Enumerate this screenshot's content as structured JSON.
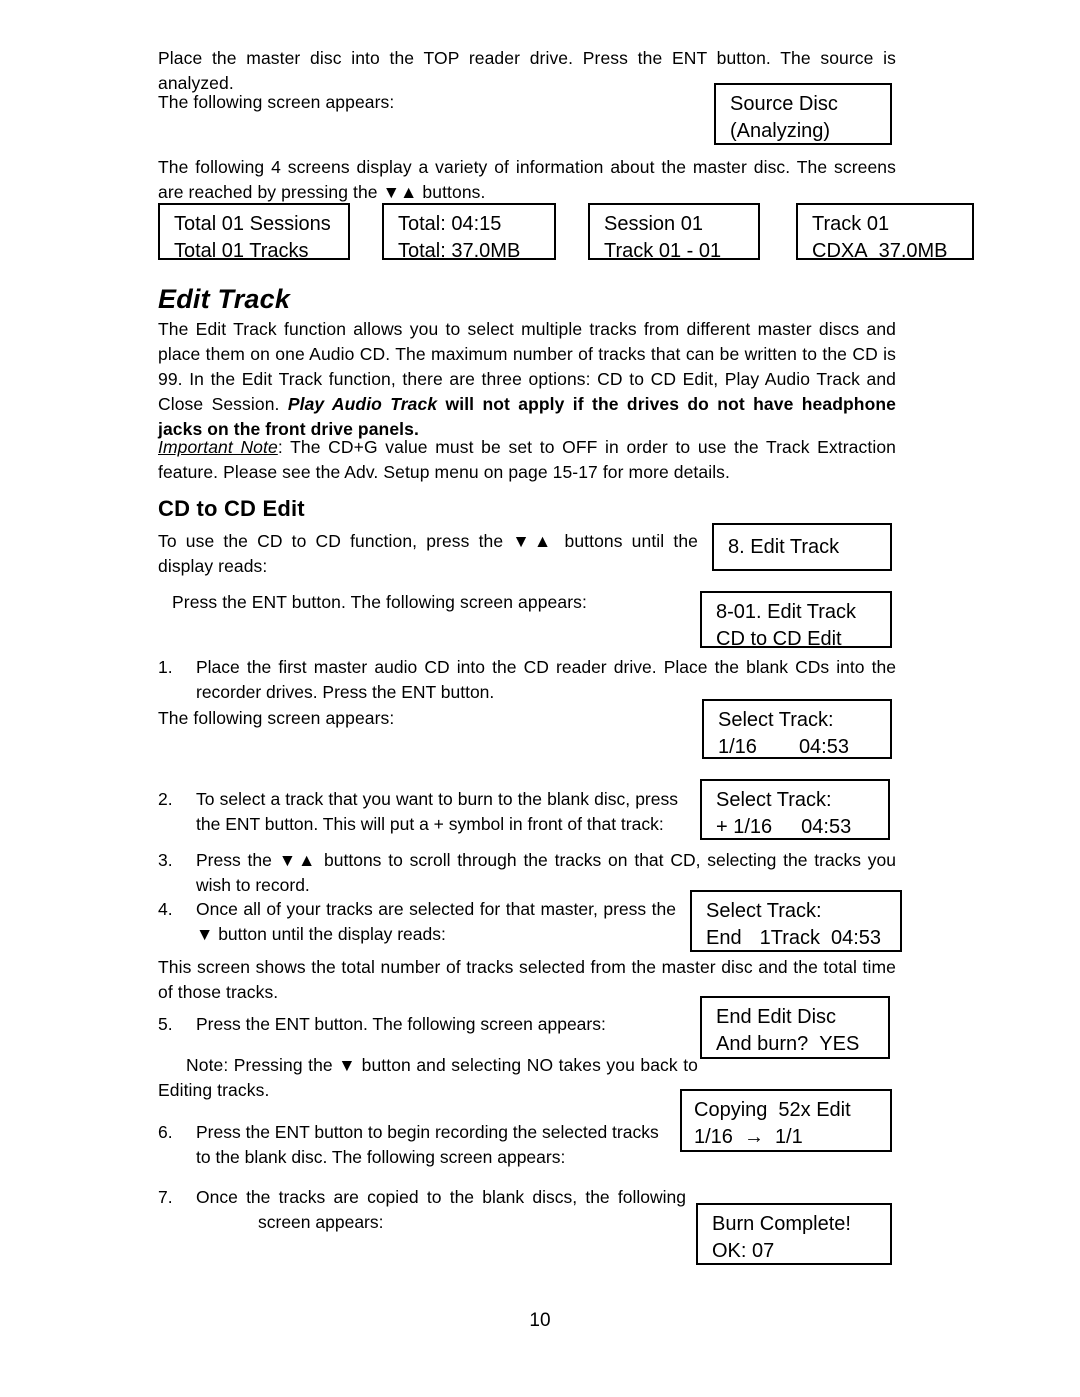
{
  "document": {
    "page_number": "10"
  },
  "intro": {
    "p1": "Place the master disc into the TOP reader drive.  Press the ENT button.  The source is analyzed.",
    "p2": "The following screen appears:",
    "p3_a": "The following 4 screens display a variety of information about the master disc.  The screens are reached by pressing the ",
    "p3_arrows": "▼▲",
    "p3_b": " buttons."
  },
  "displays": {
    "source_disc": {
      "line1": "Source Disc",
      "line2": "(Analyzing)"
    },
    "info_boxes": [
      {
        "line1": "Total 01 Sessions",
        "line2": "Total 01 Tracks"
      },
      {
        "line1": "Total: 04:15",
        "line2": "Total: 37.0MB"
      },
      {
        "line1": "Session 01",
        "line2": "Track 01 - 01"
      },
      {
        "line1": "Track 01",
        "line2_a": "CDXA",
        "line2_b": "37.0MB"
      }
    ],
    "edit_track_menu": {
      "line1": "8. Edit Track"
    },
    "edit_track_sub": {
      "line1": "8-01. Edit Track",
      "line2": "CD to CD Edit"
    },
    "select_track_1": {
      "line1": "Select Track:",
      "line2_a": "1/16",
      "line2_b": "04:53"
    },
    "select_track_2": {
      "line1": "Select Track:",
      "line2_a": "+ 1/16",
      "line2_b": "04:53"
    },
    "select_track_end": {
      "line1": "Select Track:",
      "line2_a": "End",
      "line2_b": "1Track",
      "line2_c": "04:53"
    },
    "end_edit_disc": {
      "line1": "End Edit Disc",
      "line2_a": "And burn?",
      "line2_b": "YES"
    },
    "copying": {
      "line1_a": "Copying",
      "line1_b": "52x Edit",
      "line2_a": "1/16",
      "line2_arrow": "→",
      "line2_b": "1/1"
    },
    "burn_complete": {
      "line1": "Burn Complete!",
      "line2": "OK: 07"
    }
  },
  "edit_track_section": {
    "heading": "Edit Track",
    "body_a": "The Edit Track function allows you to select multiple tracks from different master discs and place them on one Audio CD.  The maximum number of tracks that can be written to the CD is 99.  In the Edit Track function, there are three options:  CD to CD Edit, Play Audio Track and Close Session.  ",
    "body_bold_italic": "Play Audio Track",
    "body_bold": " will not apply if the drives do not have headphone jacks on the front drive panels.",
    "note_label": "Important Note",
    "note_body": ":  The CD+G value must be set to OFF in order to use the Track Extraction feature.  Please see the Adv. Setup menu on page 15-17 for more details."
  },
  "cd_to_cd_section": {
    "heading": "CD to CD Edit",
    "intro_a": "To use the CD to CD function, press the ",
    "intro_arrows": "▼▲",
    "intro_b": " buttons until the display reads:",
    "press_ent": "Press the ENT button.  The following screen appears:",
    "steps": [
      {
        "num": "1.",
        "text": "Place the first master audio CD into the CD reader drive.  Place the blank CDs into the recorder drives.  Press the ENT button."
      },
      {
        "num": "2.",
        "text": "To select a track that you want to burn to the blank disc, press the ENT button.  This will put a + symbol in front of that track:"
      },
      {
        "num": "3.",
        "text_a": "Press the ",
        "arrows": "▼▲",
        "text_b": " buttons to scroll through the tracks on that CD, selecting the tracks you wish to record."
      },
      {
        "num": "4.",
        "text_a": "Once all of your tracks are selected for that master, press the ",
        "arrow": "▼",
        "text_b": " button until the display reads:"
      },
      {
        "num": "5.",
        "text": "Press the ENT button.  The following screen appears:"
      },
      {
        "num": "6.",
        "text": "Press the ENT button to begin recording the selected tracks to the blank disc.  The following screen appears:"
      },
      {
        "num": "7.",
        "text_line1": "Once the tracks are copied to the blank discs, the following",
        "text_line2": "screen appears:"
      }
    ],
    "following_screen": "The following screen appears:",
    "total_tracks_note": "This screen shows the total number of tracks selected from the master disc and the total time of those tracks.",
    "note_a": "Note: Pressing the ",
    "note_arrow": "▼",
    "note_b": " button and selecting NO takes you back to Editing tracks."
  }
}
